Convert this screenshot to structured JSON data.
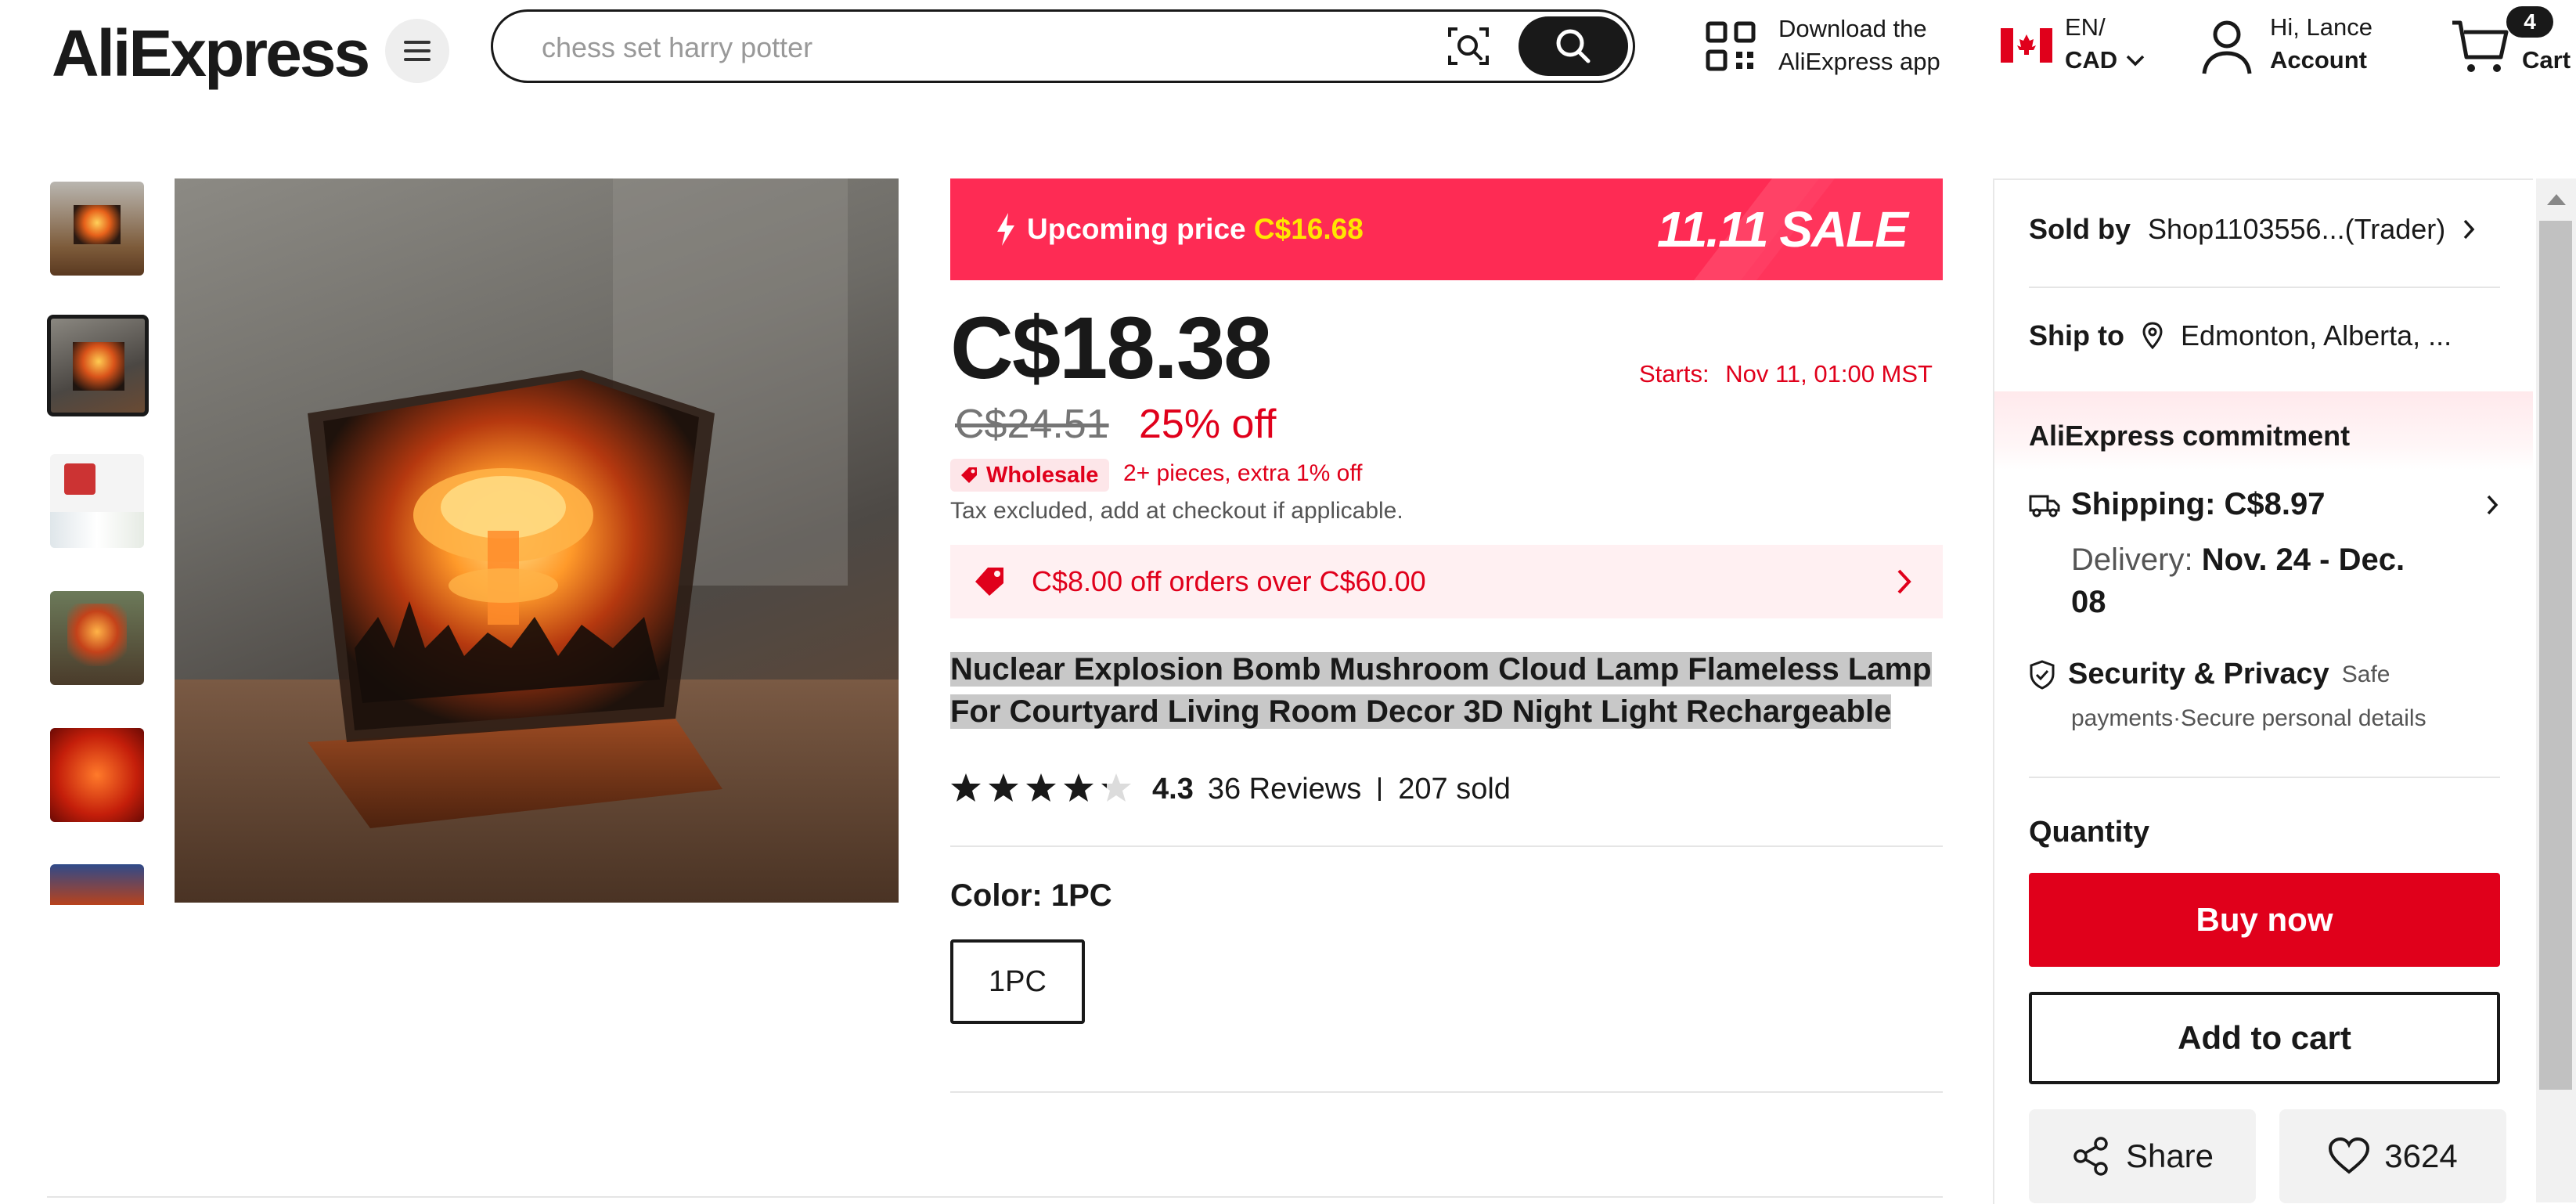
{
  "header": {
    "logo": "AliExpress",
    "search_placeholder": "chess set harry potter",
    "download_line1": "Download the",
    "download_line2": "AliExpress app",
    "locale_line1": "EN/",
    "locale_line2": "CAD",
    "account_line1": "Hi, Lance",
    "account_line2": "Account",
    "cart_count": "4",
    "cart_label": "Cart"
  },
  "product": {
    "sale_prefix": "Upcoming price",
    "sale_price": "C$16.68",
    "sale_event": "11.11 SALE",
    "price": "C$18.38",
    "old_price": "C$24.51",
    "discount": "25% off",
    "starts_label": "Starts:",
    "starts_value": "Nov 11, 01:00 MST",
    "wholesale_label": "Wholesale",
    "wholesale_text": "2+ pieces, extra 1% off",
    "tax_note": "Tax excluded, add at checkout if applicable.",
    "coupon_text": "C$8.00 off orders over C$60.00",
    "title_line1": "Nuclear Explosion Bomb Mushroom Cloud Lamp Flameless Lamp",
    "title_line2": "For Courtyard Living Room Decor 3D Night Light Rechargeable",
    "rating": "4.3",
    "rating_fraction": 0.86,
    "reviews": "36 Reviews",
    "sold": "207 sold",
    "color_label": "Color: 1PC",
    "color_option": "1PC"
  },
  "panel": {
    "sold_by_label": "Sold by",
    "sold_by_value": "Shop1103556...(Trader)",
    "ship_to_label": "Ship to",
    "ship_to_value": "Edmonton, Alberta, ...",
    "commitment_title": "AliExpress commitment",
    "shipping": "Shipping: C$8.97",
    "delivery_label": "Delivery:",
    "delivery_line1": "Nov. 24 - Dec.",
    "delivery_line2": "08",
    "security_title": "Security & Privacy",
    "security_tail": "Safe",
    "security_line2": "payments·Secure personal details",
    "quantity_label": "Quantity",
    "buy_now": "Buy now",
    "add_to_cart": "Add to cart",
    "share": "Share",
    "wishlist_count": "3624"
  },
  "colors": {
    "brand_red": "#e0001b",
    "sale_pink": "#fe2b54",
    "sale_yellow": "#ffe600"
  }
}
